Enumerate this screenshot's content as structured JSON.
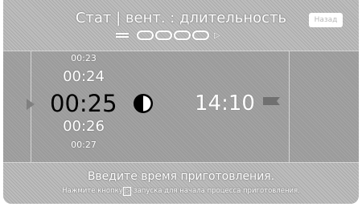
{
  "header": {
    "title": "Стат | вент. : длительность",
    "back_label": "Назад",
    "menu_icon": "menu-icon",
    "step_count": 4
  },
  "time_picker": {
    "prev_2": "00:23",
    "prev_1": "00:24",
    "selected": "00:25",
    "next_1": "00:26",
    "next_2": "00:27",
    "mode_icon": "half-moon-icon",
    "left_arrow_icon": "play-arrow-icon"
  },
  "end_time": {
    "value": "14:10",
    "icon": "finish-flag-icon"
  },
  "footer": {
    "instruction": "Введите время приготовления.",
    "hint_before": "Нажмите кнопку",
    "hint_after": "запуска для начала процесса приготовления."
  },
  "colors": {
    "background": "#bdbdbd",
    "band": "#9b9b9b",
    "text": "#ffffff",
    "selected_text": "#000000"
  }
}
